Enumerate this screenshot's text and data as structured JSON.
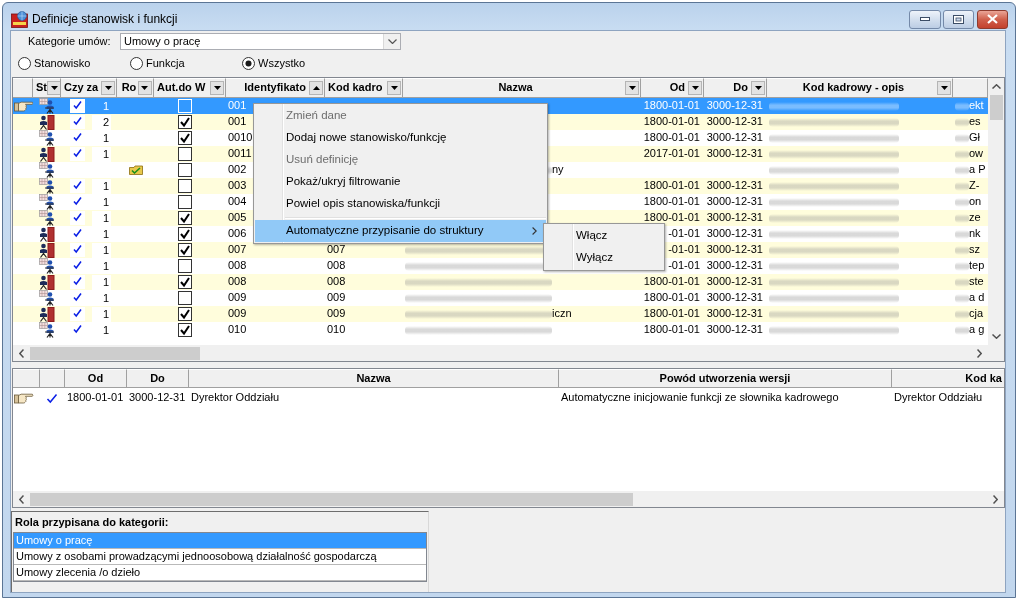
{
  "window": {
    "title": "Definicje stanowisk i funkcji"
  },
  "contract_category": {
    "label": "Kategorie umów:",
    "value": "Umowy o pracę"
  },
  "filter_options": [
    {
      "label": "Stanowisko",
      "selected": false
    },
    {
      "label": "Funkcja",
      "selected": false
    },
    {
      "label": "Wszystko",
      "selected": true
    }
  ],
  "table": {
    "columns": [
      {
        "label": "St",
        "kind": "filter"
      },
      {
        "label": "Czy za",
        "kind": "filter"
      },
      {
        "label": "Ro",
        "kind": "filter"
      },
      {
        "label": "Aut.do W",
        "kind": "filter"
      },
      {
        "label": "Identyfikato",
        "kind": "sort"
      },
      {
        "label": "Kod kadro",
        "kind": "filter"
      },
      {
        "label": "Nazwa",
        "kind": "filter"
      },
      {
        "label": "Od",
        "kind": "filter"
      },
      {
        "label": "Do",
        "kind": "filter"
      },
      {
        "label": "Kod kadrowy - opis",
        "kind": "filter"
      }
    ],
    "rows": [
      {
        "selected": true,
        "kind": "grid",
        "czy_zat_checked": true,
        "czy_zat_count": "1",
        "ro_marked": false,
        "aut_do_w_checked": false,
        "identyfikator": "001",
        "od": "1800-01-01",
        "do": "3000-12-31",
        "kod_kadrowy_opis": {
          "blurred": true
        },
        "column_11": {
          "blurred": true,
          "text": "ekt"
        }
      },
      {
        "selected": false,
        "kind": "door",
        "czy_zat_checked": true,
        "czy_zat_count": "2",
        "ro_marked": false,
        "aut_do_w_checked": true,
        "identyfikator": "001",
        "od": "1800-01-01",
        "do": "3000-12-31",
        "kod_kadrowy_opis": {
          "blurred": true
        },
        "column_11": {
          "blurred": true,
          "text": "es"
        }
      },
      {
        "selected": false,
        "kind": "grid",
        "czy_zat_checked": true,
        "czy_zat_count": "1",
        "ro_marked": false,
        "aut_do_w_checked": true,
        "identyfikator": "0010",
        "od": "1800-01-01",
        "do": "3000-12-31",
        "kod_kadrowy_opis": {
          "blurred": true
        },
        "column_11": {
          "blurred": true,
          "text": "Gł"
        }
      },
      {
        "selected": false,
        "kind": "door",
        "czy_zat_checked": true,
        "czy_zat_count": "1",
        "ro_marked": false,
        "aut_do_w_checked": false,
        "identyfikator": "0011",
        "od": "2017-01-01",
        "do": "3000-12-31",
        "kod_kadrowy_opis": {
          "blurred": true
        },
        "column_11": {
          "blurred": true,
          "text": "ow"
        }
      },
      {
        "selected": false,
        "kind": "grid",
        "czy_zat_checked": false,
        "ro_marked": true,
        "aut_do_w_checked": false,
        "identyfikator": "002",
        "nazwa": {
          "blurred": true,
          "text": "ny"
        },
        "kod_kadrowy_opis": {
          "blurred": true
        },
        "column_11": {
          "blurred": true,
          "text": "a P"
        }
      },
      {
        "selected": false,
        "kind": "grid",
        "czy_zat_checked": true,
        "czy_zat_count": "1",
        "ro_marked": false,
        "aut_do_w_checked": false,
        "identyfikator": "003",
        "od": "1800-01-01",
        "do": "3000-12-31",
        "kod_kadrowy_opis": {
          "blurred": true
        },
        "column_11": {
          "blurred": true,
          "text": "Z-"
        }
      },
      {
        "selected": false,
        "kind": "grid",
        "czy_zat_checked": true,
        "czy_zat_count": "1",
        "ro_marked": false,
        "aut_do_w_checked": false,
        "identyfikator": "004",
        "od": "1800-01-01",
        "do": "3000-12-31",
        "kod_kadrowy_opis": {
          "blurred": true
        },
        "column_11": {
          "blurred": true,
          "text": "on"
        }
      },
      {
        "selected": false,
        "kind": "grid",
        "czy_zat_checked": true,
        "czy_zat_count": "1",
        "ro_marked": false,
        "aut_do_w_checked": true,
        "identyfikator": "005",
        "od": "1800-01-01",
        "do": "3000-12-31",
        "kod_kadrowy_opis": {
          "blurred": true
        },
        "column_11": {
          "blurred": true,
          "text": "ze"
        }
      },
      {
        "selected": false,
        "kind": "door",
        "czy_zat_checked": true,
        "czy_zat_count": "1",
        "ro_marked": false,
        "aut_do_w_checked": true,
        "identyfikator": "006",
        "od": "-01-01",
        "do": "3000-12-31",
        "kod_kadrowy_opis": {
          "blurred": true
        },
        "column_11": {
          "blurred": true,
          "text": "nk"
        }
      },
      {
        "selected": false,
        "kind": "door",
        "czy_zat_checked": true,
        "czy_zat_count": "1",
        "ro_marked": false,
        "aut_do_w_checked": true,
        "identyfikator": "007",
        "kod_kadrowy": "007",
        "nazwa": {
          "blurred": true
        },
        "od": "-01-01",
        "do": "3000-12-31",
        "kod_kadrowy_opis": {
          "blurred": true
        },
        "column_11": {
          "blurred": true,
          "text": "sz"
        }
      },
      {
        "selected": false,
        "kind": "grid",
        "czy_zat_checked": true,
        "czy_zat_count": "1",
        "ro_marked": false,
        "aut_do_w_checked": false,
        "identyfikator": "008",
        "kod_kadrowy": "008",
        "nazwa": {
          "blurred": true
        },
        "od": "-01-01",
        "do": "3000-12-31",
        "kod_kadrowy_opis": {
          "blurred": true
        },
        "column_11": {
          "blurred": true,
          "text": "tep"
        }
      },
      {
        "selected": false,
        "kind": "door",
        "czy_zat_checked": true,
        "czy_zat_count": "1",
        "ro_marked": false,
        "aut_do_w_checked": true,
        "identyfikator": "008",
        "kod_kadrowy": "008",
        "nazwa": {
          "blurred": true
        },
        "od": "1800-01-01",
        "do": "3000-12-31",
        "kod_kadrowy_opis": {
          "blurred": true
        },
        "column_11": {
          "blurred": true,
          "text": "ste"
        }
      },
      {
        "selected": false,
        "kind": "grid",
        "czy_zat_checked": true,
        "czy_zat_count": "1",
        "ro_marked": false,
        "aut_do_w_checked": false,
        "identyfikator": "009",
        "kod_kadrowy": "009",
        "nazwa": {
          "blurred": true
        },
        "od": "1800-01-01",
        "do": "3000-12-31",
        "kod_kadrowy_opis": {
          "blurred": true
        },
        "column_11": {
          "blurred": true,
          "text": "a d"
        }
      },
      {
        "selected": false,
        "kind": "door",
        "czy_zat_checked": true,
        "czy_zat_count": "1",
        "ro_marked": false,
        "aut_do_w_checked": true,
        "identyfikator": "009",
        "kod_kadrowy": "009",
        "nazwa": {
          "blurred": true,
          "text": "iczn"
        },
        "od": "1800-01-01",
        "do": "3000-12-31",
        "kod_kadrowy_opis": {
          "blurred": true
        },
        "column_11": {
          "blurred": true,
          "text": "cja"
        }
      },
      {
        "selected": false,
        "kind": "grid",
        "czy_zat_checked": true,
        "czy_zat_count": "1",
        "ro_marked": false,
        "aut_do_w_checked": true,
        "identyfikator": "010",
        "kod_kadrowy": "010",
        "nazwa": {
          "blurred": true
        },
        "od": "1800-01-01",
        "do": "3000-12-31",
        "kod_kadrowy_opis": {
          "blurred": true
        },
        "column_11": {
          "blurred": true,
          "text": "a g"
        }
      }
    ]
  },
  "context_menu": {
    "items": [
      {
        "kind": "item",
        "label": "Zmień dane",
        "disabled": true,
        "selected": false,
        "submenu": false
      },
      {
        "kind": "item",
        "label": "Dodaj nowe stanowisko/funkcję",
        "disabled": false,
        "selected": false,
        "submenu": false
      },
      {
        "kind": "item",
        "label": "Usuń definicję",
        "disabled": true,
        "selected": false,
        "submenu": false
      },
      {
        "kind": "item",
        "label": "Pokaż/ukryj filtrowanie",
        "disabled": false,
        "selected": false,
        "submenu": false
      },
      {
        "kind": "item",
        "label": "Powiel opis stanowiska/funkcji",
        "disabled": false,
        "selected": false,
        "submenu": false
      },
      {
        "kind": "separator"
      },
      {
        "kind": "item",
        "label": "Automatyczne przypisanie do struktury",
        "disabled": false,
        "selected": true,
        "submenu": true
      }
    ]
  },
  "submenu": {
    "items": [
      {
        "label": "Włącz"
      },
      {
        "label": "Wyłącz"
      }
    ]
  },
  "version_table": {
    "columns": [
      "Od",
      "Do",
      "Nazwa",
      "Powód utworzenia wersji",
      "Kod ka"
    ],
    "rows": [
      {
        "selected": true,
        "checked": true,
        "cells": [
          "1800-01-01",
          "3000-12-31",
          "Dyrektor Oddziału",
          "Automatyczne inicjowanie funkcji ze słownika kadrowego",
          "Dyrektor Oddziału"
        ]
      }
    ]
  },
  "role_panel": {
    "title": "Rola przypisana do kategorii:",
    "items": [
      {
        "label": "Umowy o pracę",
        "selected": true
      },
      {
        "label": "Umowy z osobami prowadzącymi jednoosobową działalność gospodarczą",
        "selected": false
      },
      {
        "label": "Umowy zlecenia /o dzieło",
        "selected": false
      }
    ]
  }
}
